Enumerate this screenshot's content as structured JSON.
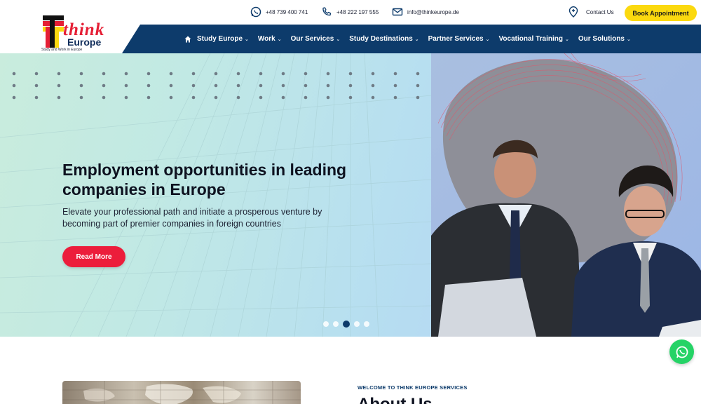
{
  "topbar": {
    "whatsapp_phone": "+48 739 400 741",
    "phone": "+48 222 197 555",
    "email": "info@thinkeurope.de",
    "contact_us": "Contact Us",
    "book_appointment": "Book Appointment"
  },
  "logo": {
    "word": "think",
    "region": "Europe",
    "tagline": "Study and Work in Europe"
  },
  "nav": {
    "items": [
      {
        "label": "Study Europe"
      },
      {
        "label": "Work"
      },
      {
        "label": "Our Services"
      },
      {
        "label": "Study Destinations"
      },
      {
        "label": "Partner Services"
      },
      {
        "label": "Vocational Training"
      },
      {
        "label": "Our Solutions"
      }
    ]
  },
  "hero": {
    "title": "Employment opportunities in leading companies in Europe",
    "text": "Elevate your professional path and initiate a prosperous venture by becoming part of premier companies in foreign countries",
    "button": "Read More",
    "slides_count": 5,
    "active_slide": 3
  },
  "about": {
    "kicker": "WELCOME TO THINK EUROPE SERVICES",
    "title": "About Us"
  },
  "colors": {
    "navy": "#0d3b6b",
    "accent_red": "#ec1d3b",
    "accent_yellow": "#fbd90f",
    "whatsapp_green": "#25d366"
  }
}
